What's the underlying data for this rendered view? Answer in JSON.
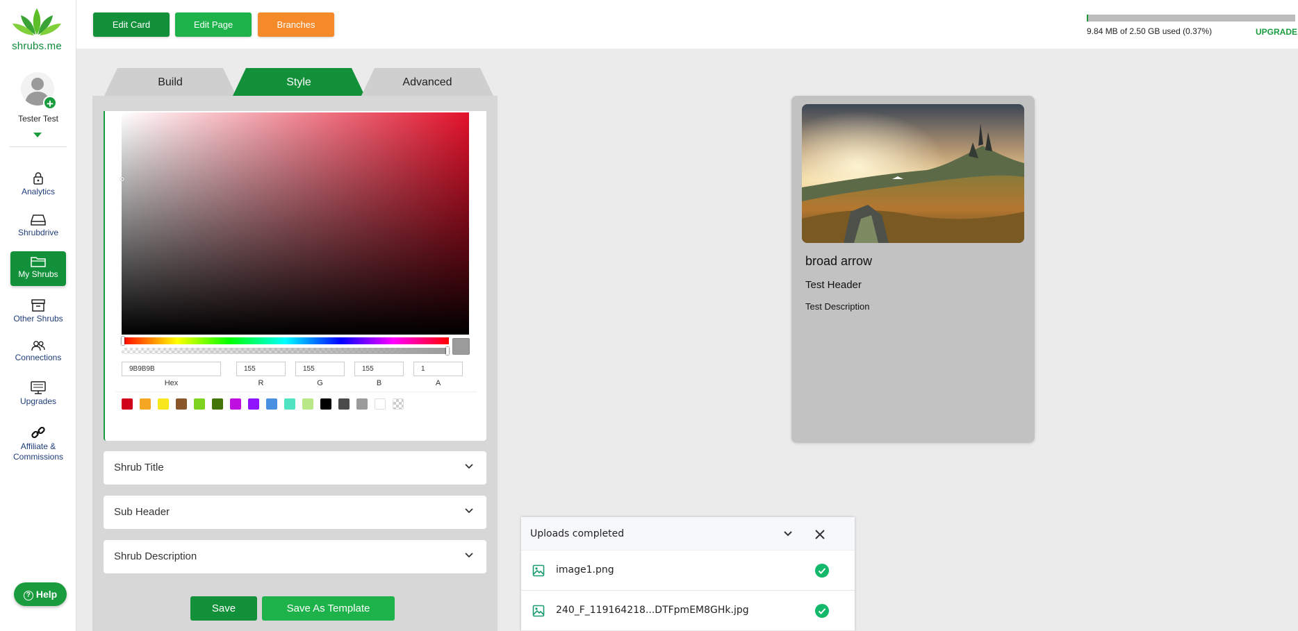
{
  "brand": {
    "name": "shrubs.me"
  },
  "user": {
    "name": "Tester Test"
  },
  "sidebar": {
    "items": [
      {
        "label": "Analytics",
        "icon": "lock-icon"
      },
      {
        "label": "Shrubdrive",
        "icon": "drive-icon"
      },
      {
        "label": "My Shrubs",
        "icon": "folder-icon",
        "active": true
      },
      {
        "label": "Other Shrubs",
        "icon": "archive-icon"
      },
      {
        "label": "Connections",
        "icon": "users-icon"
      },
      {
        "label": "Upgrades",
        "icon": "monitor-icon"
      },
      {
        "label": "Affiliate &",
        "label2": "Commissions",
        "icon": "link-icon"
      }
    ],
    "help": "Help"
  },
  "toolbar": {
    "edit_card": "Edit Card",
    "edit_page": "Edit Page",
    "branches": "Branches",
    "storage_text": "9.84 MB of 2.50 GB used (0.37%)",
    "storage_fraction": 0.0037,
    "upgrade": "UPGRADE"
  },
  "tabs": [
    {
      "label": "Build"
    },
    {
      "label": "Style",
      "active": true
    },
    {
      "label": "Advanced"
    }
  ],
  "color_picker": {
    "hex": "9B9B9B",
    "r": "155",
    "g": "155",
    "b": "155",
    "a": "1",
    "labels": {
      "hex": "Hex",
      "r": "R",
      "g": "G",
      "b": "B",
      "a": "A"
    },
    "swatches": [
      "#D0021B",
      "#F5A623",
      "#F8E71C",
      "#8B572A",
      "#7ED321",
      "#417505",
      "#BD10E0",
      "#9013FE",
      "#4A90E2",
      "#50E3C2",
      "#B8E986",
      "#000000",
      "#4A4A4A",
      "#9B9B9B",
      "#FFFFFF",
      "transparent"
    ]
  },
  "sections": {
    "shrub_title": "Shrub Title",
    "sub_header": "Sub Header",
    "shrub_description": "Shrub Description"
  },
  "actions": {
    "save": "Save",
    "save_template": "Save As Template"
  },
  "card": {
    "title": "broad arrow",
    "header": "Test Header",
    "description": "Test Description"
  },
  "uploads": {
    "title": "Uploads completed",
    "files": [
      {
        "name": "image1.png"
      },
      {
        "name": "240_F_119164218...DTFpmEM8GHk.jpg"
      }
    ]
  },
  "colors": {
    "brand_green": "#12903A",
    "accent_orange": "#F58A2A",
    "light_green": "#1EB34A"
  }
}
